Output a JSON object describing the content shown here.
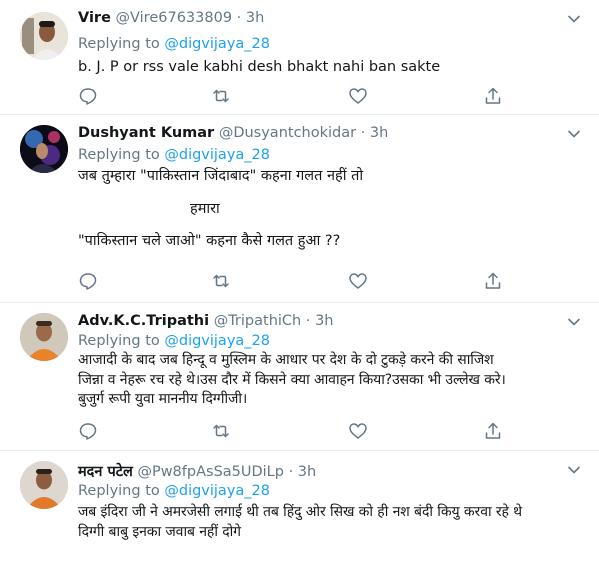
{
  "colors": {
    "link": "#1da1f2",
    "muted": "#657786",
    "text": "#14171a",
    "border": "#e6ecf0"
  },
  "icons": {
    "reply": "reply-icon",
    "retweet": "retweet-icon",
    "like": "like-icon",
    "share": "share-icon",
    "more": "chevron-down-icon"
  },
  "tweets": [
    {
      "name": "Vire",
      "handle": "@Vire67633809",
      "sep": "·",
      "time": "3h",
      "replying_label": "Replying to",
      "mention": "@digvijaya_28",
      "lines": [
        "b. J. P or rss vale kabhi desh bhakt nahi ban sakte"
      ]
    },
    {
      "name": "Dushyant Kumar",
      "handle": "@Dusyantchokidar",
      "sep": "·",
      "time": "3h",
      "replying_label": "Replying to",
      "mention": "@digvijaya_28",
      "lines": [
        "जब तुम्हारा \"पाकिस्तान जिंदाबाद\" कहना गलत नहीं तो",
        "",
        "हमारा",
        "",
        "\"पाकिस्तान चले जाओ\" कहना कैसे गलत हुआ ??"
      ]
    },
    {
      "name": "Adv.K.C.Tripathi",
      "handle": "@TripathiCh",
      "sep": "·",
      "time": "3h",
      "replying_label": "Replying to",
      "mention": "@digvijaya_28",
      "lines": [
        "आजादी के बाद जब हिन्दू व मुस्लिम के आधार पर देश के दो टुकड़े करने की साजिश",
        "जिन्ना व नेहरू रच रहे थे।उस दौर में किसने क्या आवाहन किया?उसका भी उल्लेख करे।",
        "बुजुर्ग रूपी युवा माननीय दिग्गीजी।"
      ]
    },
    {
      "name": "मदन पटेल",
      "handle": "@Pw8fpAsSa5UDiLp",
      "sep": "·",
      "time": "3h",
      "replying_label": "Replying to",
      "mention": "@digvijaya_28",
      "lines": [
        "जब इंदिरा जी ने अमरजेसी लगाई थी तब हिंदु ओर सिख को ही नश बंदी कियु करवा रहे थे",
        "दिग्गी बाबु इनका जवाब नहीं दोगे"
      ]
    }
  ]
}
